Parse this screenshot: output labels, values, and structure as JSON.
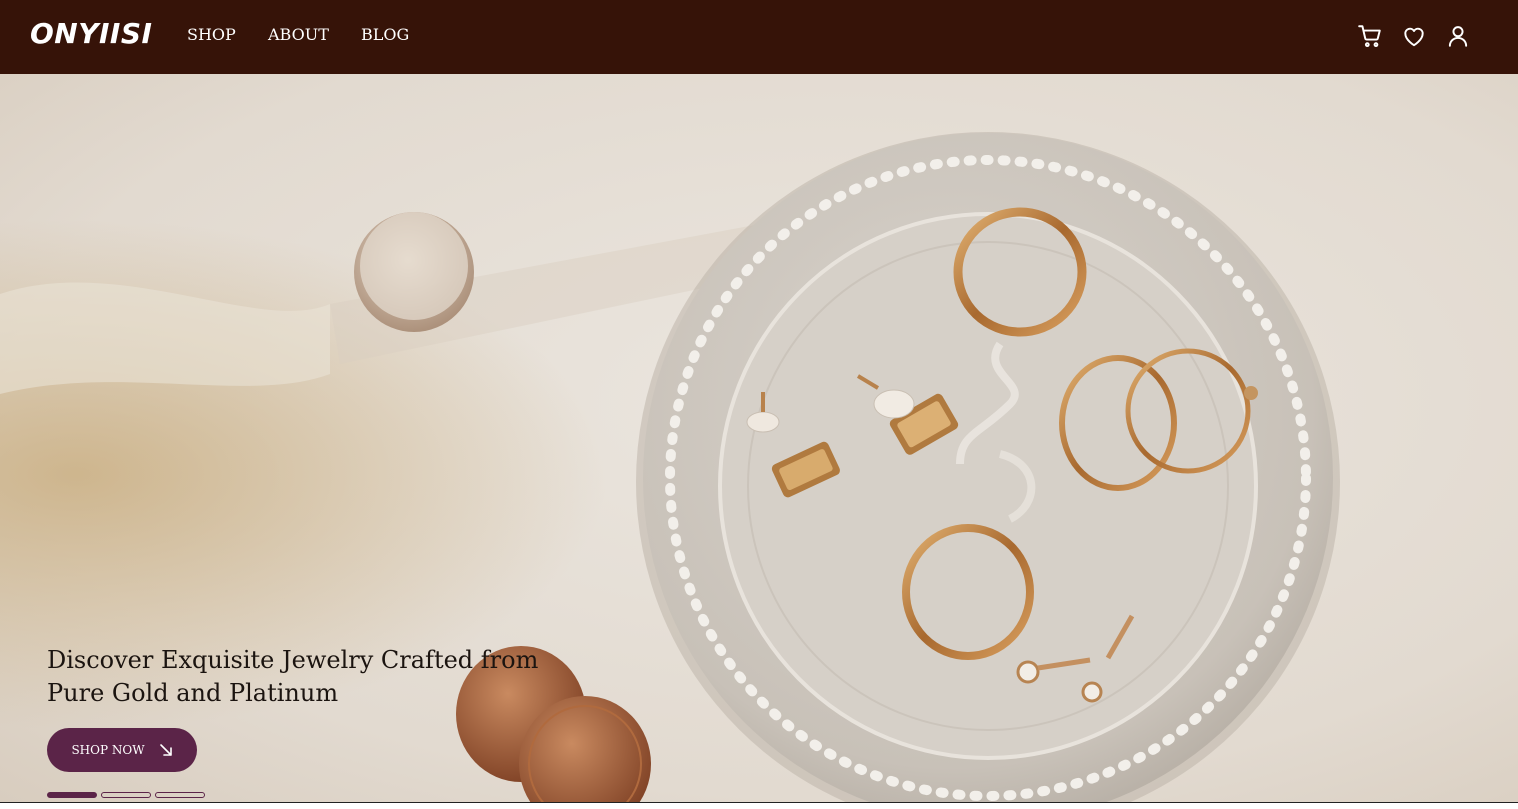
{
  "header": {
    "logo": "ONYIISI",
    "nav": [
      {
        "label": "SHOP"
      },
      {
        "label": "ABOUT"
      },
      {
        "label": "BLOG"
      }
    ],
    "icons": [
      "cart-icon",
      "heart-icon",
      "user-icon"
    ]
  },
  "hero": {
    "title": "Discover Exquisite Jewelry Crafted from Pure Gold and Platinum",
    "button_label": "SHOP NOW",
    "button_icon": "arrow-down-right-icon",
    "slides": {
      "count": 3,
      "active": 1
    }
  },
  "colors": {
    "header_bg": "#361308",
    "accent": "#5b2448",
    "text_dark": "#1b1410"
  }
}
